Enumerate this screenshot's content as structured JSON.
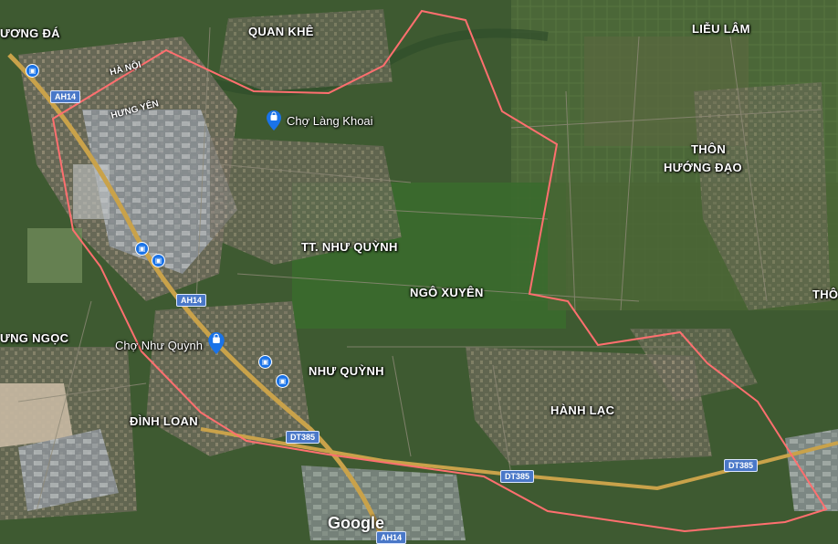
{
  "colors": {
    "boundary": "#ff6f6f",
    "road": "#c9a24a",
    "shield": "#4a78c8",
    "poi": "#1a73e8"
  },
  "places": {
    "tuong_da": "ƯƠNG ĐÁ",
    "quan_khe": "QUAN KHÊ",
    "lieu_lam": "LIỄU LÂM",
    "ha_noi": "HÀ NỘI",
    "hung_yen": "HƯNG YÊN",
    "thon_huong_dao_1": "THÔN",
    "thon_huong_dao_2": "HƯỚNG ĐẠO",
    "tt_nhu_quynh": "TT. NHƯ QUỲNH",
    "ngo_xuyen": "NGÔ XUYÊN",
    "thon_right": "THÔ",
    "ng_ngoc": "ƯNG NGỌC",
    "nhu_quynh": "NHƯ QUỲNH",
    "dinh_loan": "ĐÌNH LOAN",
    "hanh_lac": "HÀNH LẠC"
  },
  "pois": {
    "cho_lang_khoai": "Chợ Làng Khoai",
    "cho_nhu_quynh": "Chợ Như Quỳnh"
  },
  "shields": {
    "ah14_top": "AH14",
    "ah14_mid": "AH14",
    "ah14_bottom": "AH14",
    "dt385_left": "DT385",
    "dt385_mid": "DT385",
    "dt385_right": "DT385"
  },
  "icons": {
    "bus": "bus-stop-icon",
    "shopping": "shopping-bag-pin-icon"
  },
  "logo": "Google"
}
